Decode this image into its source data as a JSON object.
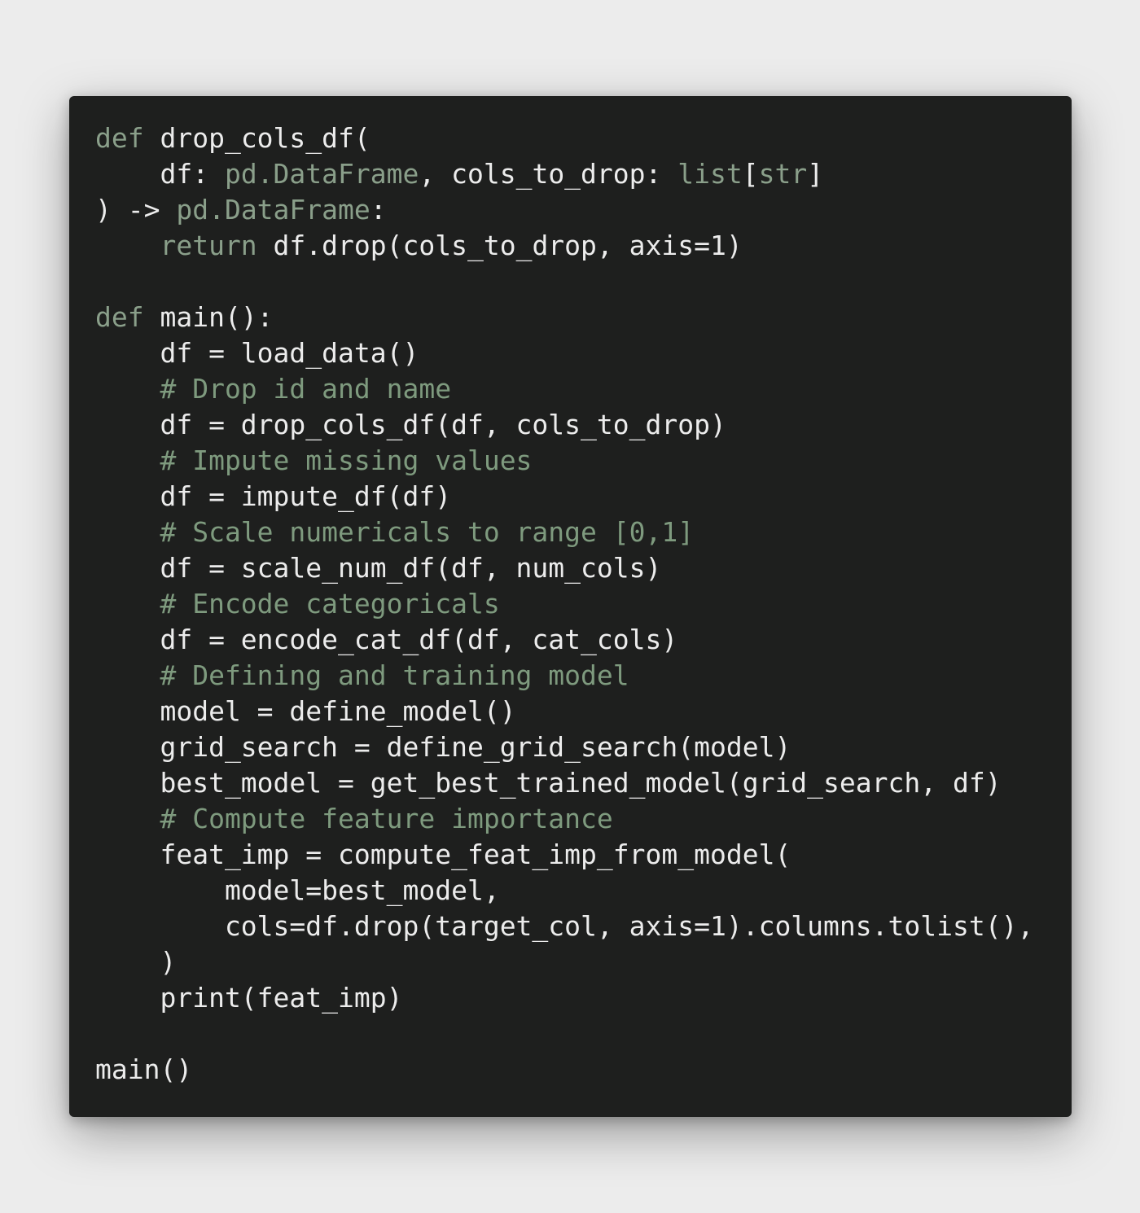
{
  "colors": {
    "background": "#ececec",
    "editor_background": "#1e1f1e",
    "plain_text": "#ececec",
    "keyword": "#8a9f8a",
    "type": "#8a9f8a",
    "comment": "#7e9a7e"
  },
  "code": {
    "language": "python",
    "lines": [
      [
        {
          "t": "kw",
          "v": "def"
        },
        {
          "t": "plain",
          "v": " drop_cols_df("
        }
      ],
      [
        {
          "t": "plain",
          "v": "    df: "
        },
        {
          "t": "type",
          "v": "pd.DataFrame"
        },
        {
          "t": "plain",
          "v": ", cols_to_drop: "
        },
        {
          "t": "type",
          "v": "list"
        },
        {
          "t": "plain",
          "v": "["
        },
        {
          "t": "type",
          "v": "str"
        },
        {
          "t": "plain",
          "v": "]"
        }
      ],
      [
        {
          "t": "plain",
          "v": ") -> "
        },
        {
          "t": "type",
          "v": "pd.DataFrame"
        },
        {
          "t": "plain",
          "v": ":"
        }
      ],
      [
        {
          "t": "kw",
          "v": "    return"
        },
        {
          "t": "plain",
          "v": " df.drop(cols_to_drop, axis=1)"
        }
      ],
      [],
      [
        {
          "t": "kw",
          "v": "def"
        },
        {
          "t": "plain",
          "v": " main():"
        }
      ],
      [
        {
          "t": "plain",
          "v": "    df = load_data()"
        }
      ],
      [
        {
          "t": "comment",
          "v": "    # Drop id and name"
        }
      ],
      [
        {
          "t": "plain",
          "v": "    df = drop_cols_df(df, cols_to_drop)"
        }
      ],
      [
        {
          "t": "comment",
          "v": "    # Impute missing values"
        }
      ],
      [
        {
          "t": "plain",
          "v": "    df = impute_df(df)"
        }
      ],
      [
        {
          "t": "comment",
          "v": "    # Scale numericals to range [0,1]"
        }
      ],
      [
        {
          "t": "plain",
          "v": "    df = scale_num_df(df, num_cols)"
        }
      ],
      [
        {
          "t": "comment",
          "v": "    # Encode categoricals"
        }
      ],
      [
        {
          "t": "plain",
          "v": "    df = encode_cat_df(df, cat_cols)"
        }
      ],
      [
        {
          "t": "comment",
          "v": "    # Defining and training model"
        }
      ],
      [
        {
          "t": "plain",
          "v": "    model = define_model()"
        }
      ],
      [
        {
          "t": "plain",
          "v": "    grid_search = define_grid_search(model)"
        }
      ],
      [
        {
          "t": "plain",
          "v": "    best_model = get_best_trained_model(grid_search, df)"
        }
      ],
      [
        {
          "t": "comment",
          "v": "    # Compute feature importance"
        }
      ],
      [
        {
          "t": "plain",
          "v": "    feat_imp = compute_feat_imp_from_model("
        }
      ],
      [
        {
          "t": "plain",
          "v": "        model=best_model,"
        }
      ],
      [
        {
          "t": "plain",
          "v": "        cols=df.drop(target_col, axis=1).columns.tolist(),"
        }
      ],
      [
        {
          "t": "plain",
          "v": "    )"
        }
      ],
      [
        {
          "t": "plain",
          "v": "    print(feat_imp)"
        }
      ],
      [],
      [
        {
          "t": "plain",
          "v": "main()"
        }
      ]
    ]
  }
}
